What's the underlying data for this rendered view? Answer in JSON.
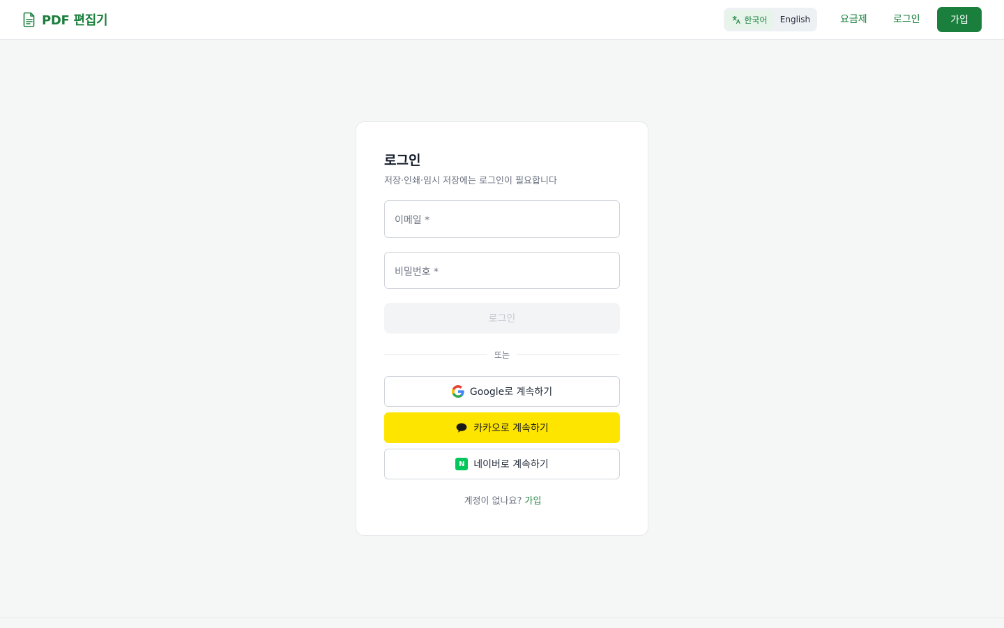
{
  "header": {
    "brand": "PDF 편집기",
    "language": {
      "korean": "한국어",
      "english": "English",
      "selected": "한국어"
    },
    "nav": {
      "pricing": "요금제",
      "login": "로그인"
    },
    "signup": "가입"
  },
  "login_card": {
    "title": "로그인",
    "subtitle": "저장·인쇄·임시 저장에는 로그인이 필요합니다",
    "email_label": "이메일 *",
    "password_label": "비밀번호 *",
    "submit": "로그인",
    "divider": "또는",
    "google": "Google로 계속하기",
    "kakao": "카카오로 계속하기",
    "naver": "네이버로 계속하기",
    "no_account": "계정이 없나요?",
    "signup_link": "가입"
  },
  "colors": {
    "brand_green": "#1a7f3c",
    "kakao_yellow": "#fee500",
    "naver_green": "#03c75a",
    "background": "#f5f7f6"
  }
}
